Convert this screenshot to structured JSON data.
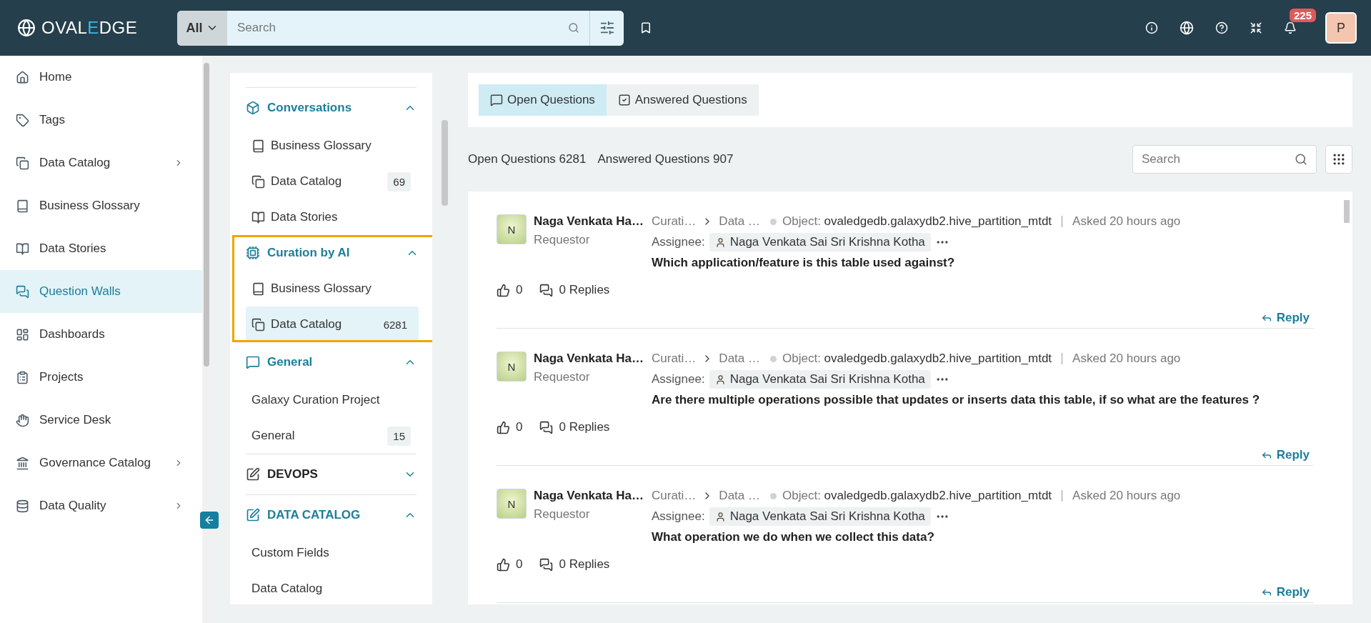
{
  "header": {
    "logo": {
      "lead": "OVAL",
      "accent": "E",
      "tail": "DGE"
    },
    "scope": "All",
    "search_placeholder": "Search",
    "notifications": "225",
    "avatar": "P"
  },
  "sidebar": {
    "items": [
      {
        "label": "Home",
        "kind": "home",
        "selected": false,
        "expandable": false
      },
      {
        "label": "Tags",
        "kind": "tag",
        "selected": false,
        "expandable": false
      },
      {
        "label": "Data Catalog",
        "kind": "catalog",
        "selected": false,
        "expandable": true
      },
      {
        "label": "Business Glossary",
        "kind": "glossary",
        "selected": false,
        "expandable": false
      },
      {
        "label": "Data Stories",
        "kind": "stories",
        "selected": false,
        "expandable": false
      },
      {
        "label": "Question Walls",
        "kind": "questions",
        "selected": true,
        "expandable": false
      },
      {
        "label": "Dashboards",
        "kind": "dashboard",
        "selected": false,
        "expandable": false
      },
      {
        "label": "Projects",
        "kind": "projects",
        "selected": false,
        "expandable": false
      },
      {
        "label": "Service Desk",
        "kind": "service",
        "selected": false,
        "expandable": false
      },
      {
        "label": "Governance Catalog",
        "kind": "governance",
        "selected": false,
        "expandable": true
      },
      {
        "label": "Data Quality",
        "kind": "quality",
        "selected": false,
        "expandable": true
      }
    ]
  },
  "walls": [
    {
      "title": "Conversations",
      "kind": "cube",
      "expanded": true,
      "highlighted": false,
      "items": [
        {
          "label": "Business Glossary",
          "kind": "glossary",
          "selected": false
        },
        {
          "label": "Data Catalog",
          "kind": "catalog",
          "count": "69",
          "selected": false
        },
        {
          "label": "Data Stories",
          "kind": "stories",
          "selected": false
        }
      ]
    },
    {
      "title": "Curation by AI",
      "kind": "chip",
      "expanded": true,
      "highlighted": true,
      "items": [
        {
          "label": "Business Glossary",
          "kind": "glossary",
          "selected": false
        },
        {
          "label": "Data Catalog",
          "kind": "catalog",
          "count": "6281",
          "selected": true
        }
      ]
    },
    {
      "title": "General",
      "kind": "chat",
      "expanded": true,
      "highlighted": false,
      "items": [
        {
          "label": "Galaxy Curation Project",
          "selected": false
        },
        {
          "label": "General",
          "count": "15",
          "selected": false
        }
      ]
    },
    {
      "title": "DEVOPS",
      "kind": "edit",
      "expanded": false,
      "highlighted": false
    },
    {
      "title": "DATA CATALOG",
      "kind": "edit",
      "expanded": true,
      "highlighted": false,
      "items": [
        {
          "label": "Custom Fields",
          "selected": false
        },
        {
          "label": "Data Catalog",
          "selected": false
        }
      ]
    }
  ],
  "tabs": [
    {
      "label": "Open Questions",
      "kind": "chat",
      "selected": true
    },
    {
      "label": "Answered Questions",
      "kind": "check",
      "selected": false
    }
  ],
  "counts": [
    "Open Questions 6281",
    "Answered Questions 907"
  ],
  "search_placeholder": "Search",
  "questions": [
    {
      "avatar": "N",
      "name": "Naga Venkata Ha…",
      "role": "Requestor",
      "path": [
        "Curati…",
        "Data …"
      ],
      "object_label": "Object:",
      "object": "ovaledgedb.galaxydb2.hive_partition_mtdt",
      "asked": "Asked 20 hours ago",
      "assignee_label": "Assignee:",
      "assignee": "Naga Venkata Sai Sri Krishna Kotha",
      "question": "Which application/feature is this table used against?",
      "likes": "0",
      "replies": "0 Replies",
      "reply": "Reply"
    },
    {
      "avatar": "N",
      "name": "Naga Venkata Ha…",
      "role": "Requestor",
      "path": [
        "Curati…",
        "Data …"
      ],
      "object_label": "Object:",
      "object": "ovaledgedb.galaxydb2.hive_partition_mtdt",
      "asked": "Asked 20 hours ago",
      "assignee_label": "Assignee:",
      "assignee": "Naga Venkata Sai Sri Krishna Kotha",
      "question": "Are there multiple operations possible that updates or inserts data this table, if so what are the features ?",
      "likes": "0",
      "replies": "0 Replies",
      "reply": "Reply"
    },
    {
      "avatar": "N",
      "name": "Naga Venkata Ha…",
      "role": "Requestor",
      "path": [
        "Curati…",
        "Data …"
      ],
      "object_label": "Object:",
      "object": "ovaledgedb.galaxydb2.hive_partition_mtdt",
      "asked": "Asked 20 hours ago",
      "assignee_label": "Assignee:",
      "assignee": "Naga Venkata Sai Sri Krishna Kotha",
      "question": "What operation we do when we collect this data?",
      "likes": "0",
      "replies": "0 Replies",
      "reply": "Reply"
    }
  ]
}
